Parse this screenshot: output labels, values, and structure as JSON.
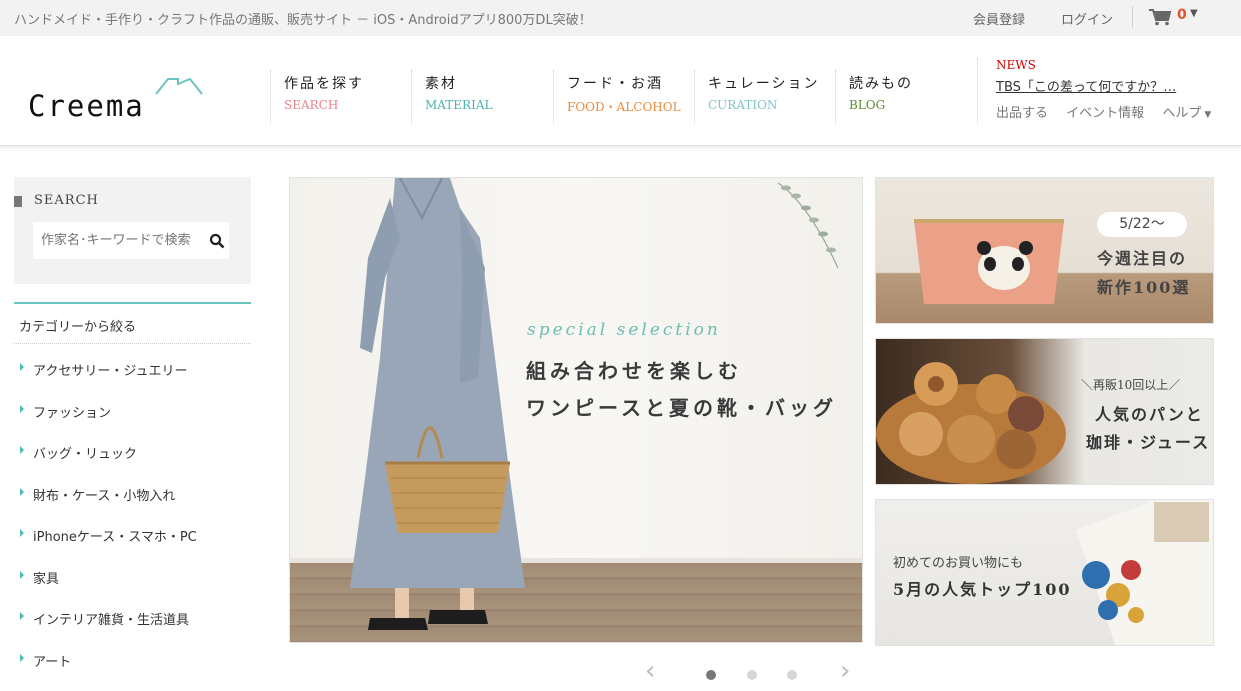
{
  "topbar": {
    "tagline": "ハンドメイド・手作り・クラフト作品の通販、販売サイト － iOS・Androidアプリ800万DL突破！",
    "register": "会員登録",
    "login": "ログイン",
    "cart_count": "0",
    "cart_icon": "cart-icon"
  },
  "logo": {
    "text": "Creema"
  },
  "nav": [
    {
      "jp": "作品を探す",
      "en": "SEARCH",
      "color": "#e8848a"
    },
    {
      "jp": "素材",
      "en": "MATERIAL",
      "color": "#4fb3ae"
    },
    {
      "jp": "フード・お酒",
      "en": "FOOD・ALCOHOL",
      "color": "#ee8a3c"
    },
    {
      "jp": "キュレーション",
      "en": "CURATION",
      "color": "#7fc6c8"
    },
    {
      "jp": "読みもの",
      "en": "BLOG",
      "color": "#5d8a2f"
    }
  ],
  "news": {
    "label": "NEWS",
    "headline": "TBS「この差って何ですか？…",
    "links": [
      "出品する",
      "イベント情報",
      "ヘルプ"
    ]
  },
  "search": {
    "title": "SEARCH",
    "placeholder": "作家名･キーワードで検索"
  },
  "categories": {
    "title": "カテゴリーから絞る",
    "items": [
      "アクセサリー・ジュエリー",
      "ファッション",
      "バッグ・リュック",
      "財布・ケース・小物入れ",
      "iPhoneケース・スマホ・PC",
      "家具",
      "インテリア雑貨・生活道具",
      "アート"
    ]
  },
  "hero": {
    "subtitle": "special selection",
    "line1": "組み合わせを楽しむ",
    "line2": "ワンピースと夏の靴・バッグ"
  },
  "banners": {
    "b1": {
      "pill": "5/22〜",
      "line1": "今週注目の",
      "line2": "新作100選"
    },
    "b2": {
      "line0": "＼再販10回以上／",
      "line1": "人気のパンと",
      "line2": "珈琲・ジュース"
    },
    "b3": {
      "line1": "初めてのお買い物にも",
      "line2": "5月の人気トップ100"
    }
  },
  "carousel": {
    "prev": "＜",
    "next": "＞",
    "active_index": 0,
    "count": 3
  },
  "colors": {
    "accent": "#4dbbb6",
    "news": "#d20000",
    "cart": "#e2542b"
  }
}
